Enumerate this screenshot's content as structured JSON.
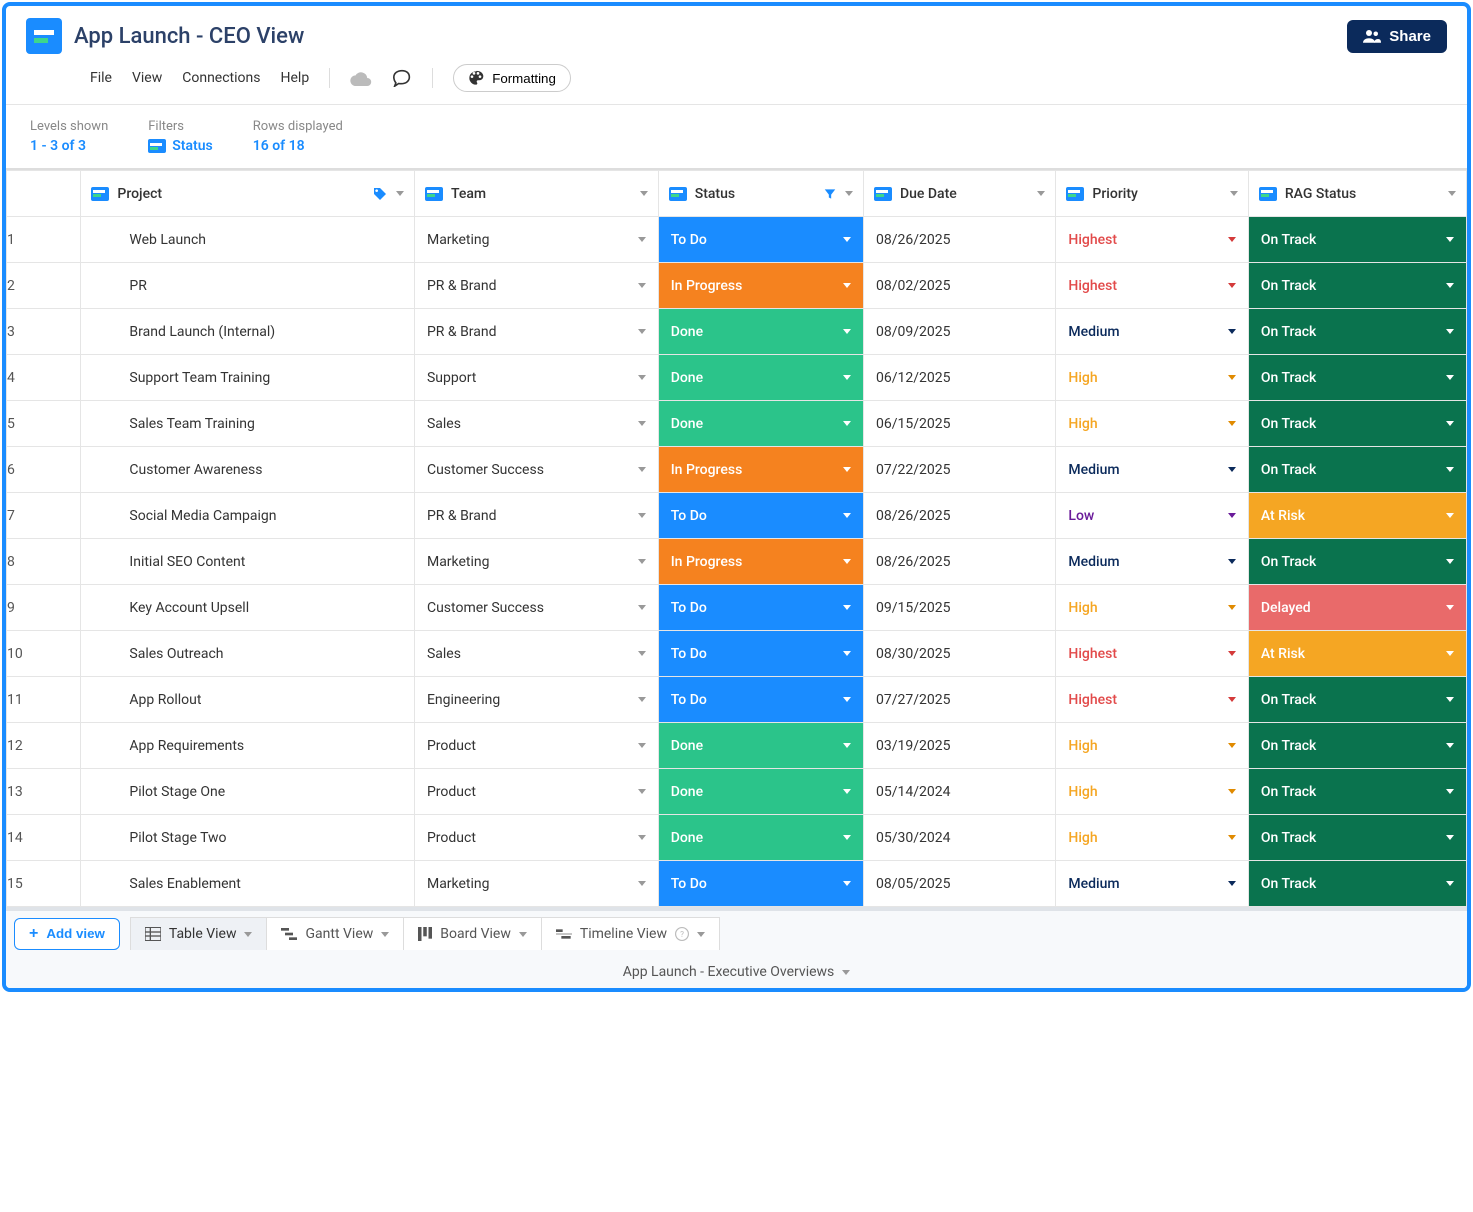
{
  "header": {
    "title": "App Launch - CEO View",
    "share_label": "Share"
  },
  "menu": {
    "file": "File",
    "view": "View",
    "connections": "Connections",
    "help": "Help",
    "formatting": "Formatting"
  },
  "stats": {
    "levels_label": "Levels shown",
    "levels_value": "1 - 3 of 3",
    "filters_label": "Filters",
    "filters_value": "Status",
    "rows_label": "Rows displayed",
    "rows_value": "16 of 18"
  },
  "columns": {
    "project": "Project",
    "team": "Team",
    "status": "Status",
    "due": "Due Date",
    "priority": "Priority",
    "rag": "RAG Status"
  },
  "status_colors": {
    "To Do": "todo",
    "In Progress": "inprogress",
    "Done": "done"
  },
  "rag_colors": {
    "On Track": "ontrack",
    "At Risk": "atrisk",
    "Delayed": "delayed"
  },
  "priority_classes": {
    "Highest": "highest",
    "High": "high",
    "Medium": "medium",
    "Low": "low"
  },
  "rows": [
    {
      "n": 1,
      "project": "Web Launch",
      "team": "Marketing",
      "status": "To Do",
      "due": "08/26/2025",
      "priority": "Highest",
      "rag": "On Track"
    },
    {
      "n": 2,
      "project": "PR",
      "team": "PR & Brand",
      "status": "In Progress",
      "due": "08/02/2025",
      "priority": "Highest",
      "rag": "On Track"
    },
    {
      "n": 3,
      "project": "Brand Launch (Internal)",
      "team": "PR & Brand",
      "status": "Done",
      "due": "08/09/2025",
      "priority": "Medium",
      "rag": "On Track"
    },
    {
      "n": 4,
      "project": "Support Team Training",
      "team": "Support",
      "status": "Done",
      "due": "06/12/2025",
      "priority": "High",
      "rag": "On Track"
    },
    {
      "n": 5,
      "project": "Sales Team Training",
      "team": "Sales",
      "status": "Done",
      "due": "06/15/2025",
      "priority": "High",
      "rag": "On Track"
    },
    {
      "n": 6,
      "project": "Customer Awareness",
      "team": "Customer Success",
      "status": "In Progress",
      "due": "07/22/2025",
      "priority": "Medium",
      "rag": "On Track"
    },
    {
      "n": 7,
      "project": "Social Media Campaign",
      "team": "PR & Brand",
      "status": "To Do",
      "due": "08/26/2025",
      "priority": "Low",
      "rag": "At Risk"
    },
    {
      "n": 8,
      "project": "Initial SEO Content",
      "team": "Marketing",
      "status": "In Progress",
      "due": "08/26/2025",
      "priority": "Medium",
      "rag": "On Track"
    },
    {
      "n": 9,
      "project": "Key Account Upsell",
      "team": "Customer Success",
      "status": "To Do",
      "due": "09/15/2025",
      "priority": "High",
      "rag": "Delayed"
    },
    {
      "n": 10,
      "project": "Sales Outreach",
      "team": "Sales",
      "status": "To Do",
      "due": "08/30/2025",
      "priority": "Highest",
      "rag": "At Risk"
    },
    {
      "n": 11,
      "project": "App Rollout",
      "team": "Engineering",
      "status": "To Do",
      "due": "07/27/2025",
      "priority": "Highest",
      "rag": "On Track"
    },
    {
      "n": 12,
      "project": "App Requirements",
      "team": "Product",
      "status": "Done",
      "due": "03/19/2025",
      "priority": "High",
      "rag": "On Track"
    },
    {
      "n": 13,
      "project": "Pilot Stage One",
      "team": "Product",
      "status": "Done",
      "due": "05/14/2024",
      "priority": "High",
      "rag": "On Track"
    },
    {
      "n": 14,
      "project": "Pilot Stage Two",
      "team": "Product",
      "status": "Done",
      "due": "05/30/2024",
      "priority": "High",
      "rag": "On Track"
    },
    {
      "n": 15,
      "project": "Sales Enablement",
      "team": "Marketing",
      "status": "To Do",
      "due": "08/05/2025",
      "priority": "Medium",
      "rag": "On Track"
    }
  ],
  "footer": {
    "add_view": "Add view",
    "tabs": [
      "Table View",
      "Gantt View",
      "Board View",
      "Timeline View"
    ],
    "overview": "App Launch - Executive Overviews"
  }
}
